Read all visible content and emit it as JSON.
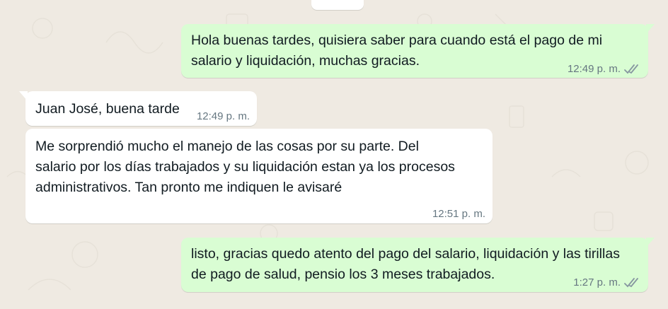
{
  "chat": {
    "messages": [
      {
        "direction": "outgoing",
        "text": "Hola buenas tardes, quisiera saber para cuando está el pago de mi salario y liquidación, muchas gracias.",
        "time": "12:49 p. m.",
        "status": "read-double-check"
      },
      {
        "direction": "incoming",
        "text": "Juan José, buena tarde",
        "time": "12:49 p. m."
      },
      {
        "direction": "incoming",
        "text": "Me sorprendió mucho el manejo de las cosas por su parte. Del salario por los días trabajados y su liquidación estan ya los procesos administrativos. Tan pronto me indiquen le avisaré",
        "time": "12:51 p. m."
      },
      {
        "direction": "outgoing",
        "text": "listo, gracias quedo atento del pago del salario, liquidación y las tirillas de pago de salud, pensio los 3 meses trabajados.",
        "time": "1:27 p. m.",
        "status": "read-double-check"
      }
    ]
  },
  "colors": {
    "background": "#efeae2",
    "outgoing_bubble": "#d9fdd3",
    "incoming_bubble": "#ffffff",
    "timestamp": "#667781",
    "check_marks": "#8696a0"
  },
  "icons": {
    "delivery_status": "double-check-icon"
  }
}
